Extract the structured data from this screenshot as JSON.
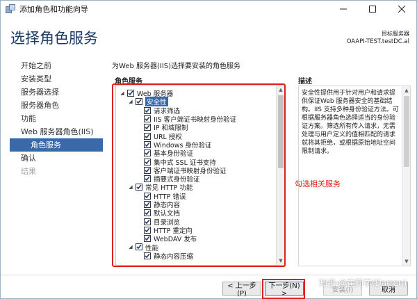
{
  "window": {
    "title": "添加角色和功能向导"
  },
  "header": {
    "page_title": "选择角色服务",
    "server_caption": "目标服务器",
    "server_name": "OAAPI-TEST.testDC.al"
  },
  "nav": {
    "items": [
      {
        "label": "开始之前",
        "state": "normal"
      },
      {
        "label": "安装类型",
        "state": "normal"
      },
      {
        "label": "服务器选择",
        "state": "normal"
      },
      {
        "label": "服务器角色",
        "state": "normal"
      },
      {
        "label": "功能",
        "state": "normal"
      },
      {
        "label": "Web 服务器角色(IIS)",
        "state": "normal"
      },
      {
        "label": "角色服务",
        "state": "active"
      },
      {
        "label": "确认",
        "state": "normal"
      },
      {
        "label": "结果",
        "state": "disabled"
      }
    ]
  },
  "main": {
    "instruction": "为Web 服务器(IIS)选择要安装的角色服务",
    "role_services_label": "角色服务",
    "description_label": "描述",
    "description_text": "安全性提供用于针对用户和请求提供保证Web 服务器安全的基础结构。IIS 支持多种身份验证方法。可根据服务器角色选择适当的身份验证方案。筛选所有传入请求，无需处理与用户定义的值相匹配的请求就将其拒绝，或根据原始地址空间限制请求。",
    "annotation": "勾选相关服务",
    "tree": [
      {
        "label": "Web 服务器",
        "level": 0,
        "expander": "open",
        "checked": true
      },
      {
        "label": "安全性",
        "level": 1,
        "expander": "open",
        "checked": true,
        "selected": true
      },
      {
        "label": "请求筛选",
        "level": 2,
        "expander": "none",
        "checked": true
      },
      {
        "label": "IIS 客户端证书映射身份验证",
        "level": 2,
        "expander": "none",
        "checked": true
      },
      {
        "label": "IP 和域限制",
        "level": 2,
        "expander": "none",
        "checked": true
      },
      {
        "label": "URL 授权",
        "level": 2,
        "expander": "none",
        "checked": true
      },
      {
        "label": "Windows 身份验证",
        "level": 2,
        "expander": "none",
        "checked": true
      },
      {
        "label": "基本身份验证",
        "level": 2,
        "expander": "none",
        "checked": true
      },
      {
        "label": "集中式 SSL 证书支持",
        "level": 2,
        "expander": "none",
        "checked": true
      },
      {
        "label": "客户端证书映射身份验证",
        "level": 2,
        "expander": "none",
        "checked": true
      },
      {
        "label": "摘要式身份验证",
        "level": 2,
        "expander": "none",
        "checked": true
      },
      {
        "label": "常见 HTTP 功能",
        "level": 1,
        "expander": "open",
        "checked": true
      },
      {
        "label": "HTTP 错误",
        "level": 2,
        "expander": "none",
        "checked": true
      },
      {
        "label": "静态内容",
        "level": 2,
        "expander": "none",
        "checked": true
      },
      {
        "label": "默认文档",
        "level": 2,
        "expander": "none",
        "checked": true
      },
      {
        "label": "目录浏览",
        "level": 2,
        "expander": "none",
        "checked": true
      },
      {
        "label": "HTTP 重定向",
        "level": 2,
        "expander": "none",
        "checked": true
      },
      {
        "label": "WebDAV 发布",
        "level": 2,
        "expander": "none",
        "checked": true
      },
      {
        "label": "性能",
        "level": 1,
        "expander": "open",
        "checked": true
      },
      {
        "label": "静态内容压缩",
        "level": 2,
        "expander": "none",
        "checked": true
      }
    ]
  },
  "footer": {
    "prev_label": "< 上一步(P)",
    "next_label": "下一步(N) >",
    "install_label": "安装(I)",
    "cancel_label": "取消",
    "watermark": "知乎 @崔同学(Darren)"
  },
  "colors": {
    "accent": "#3a68a8",
    "title": "#1a3a66",
    "highlight": "#e02020"
  }
}
